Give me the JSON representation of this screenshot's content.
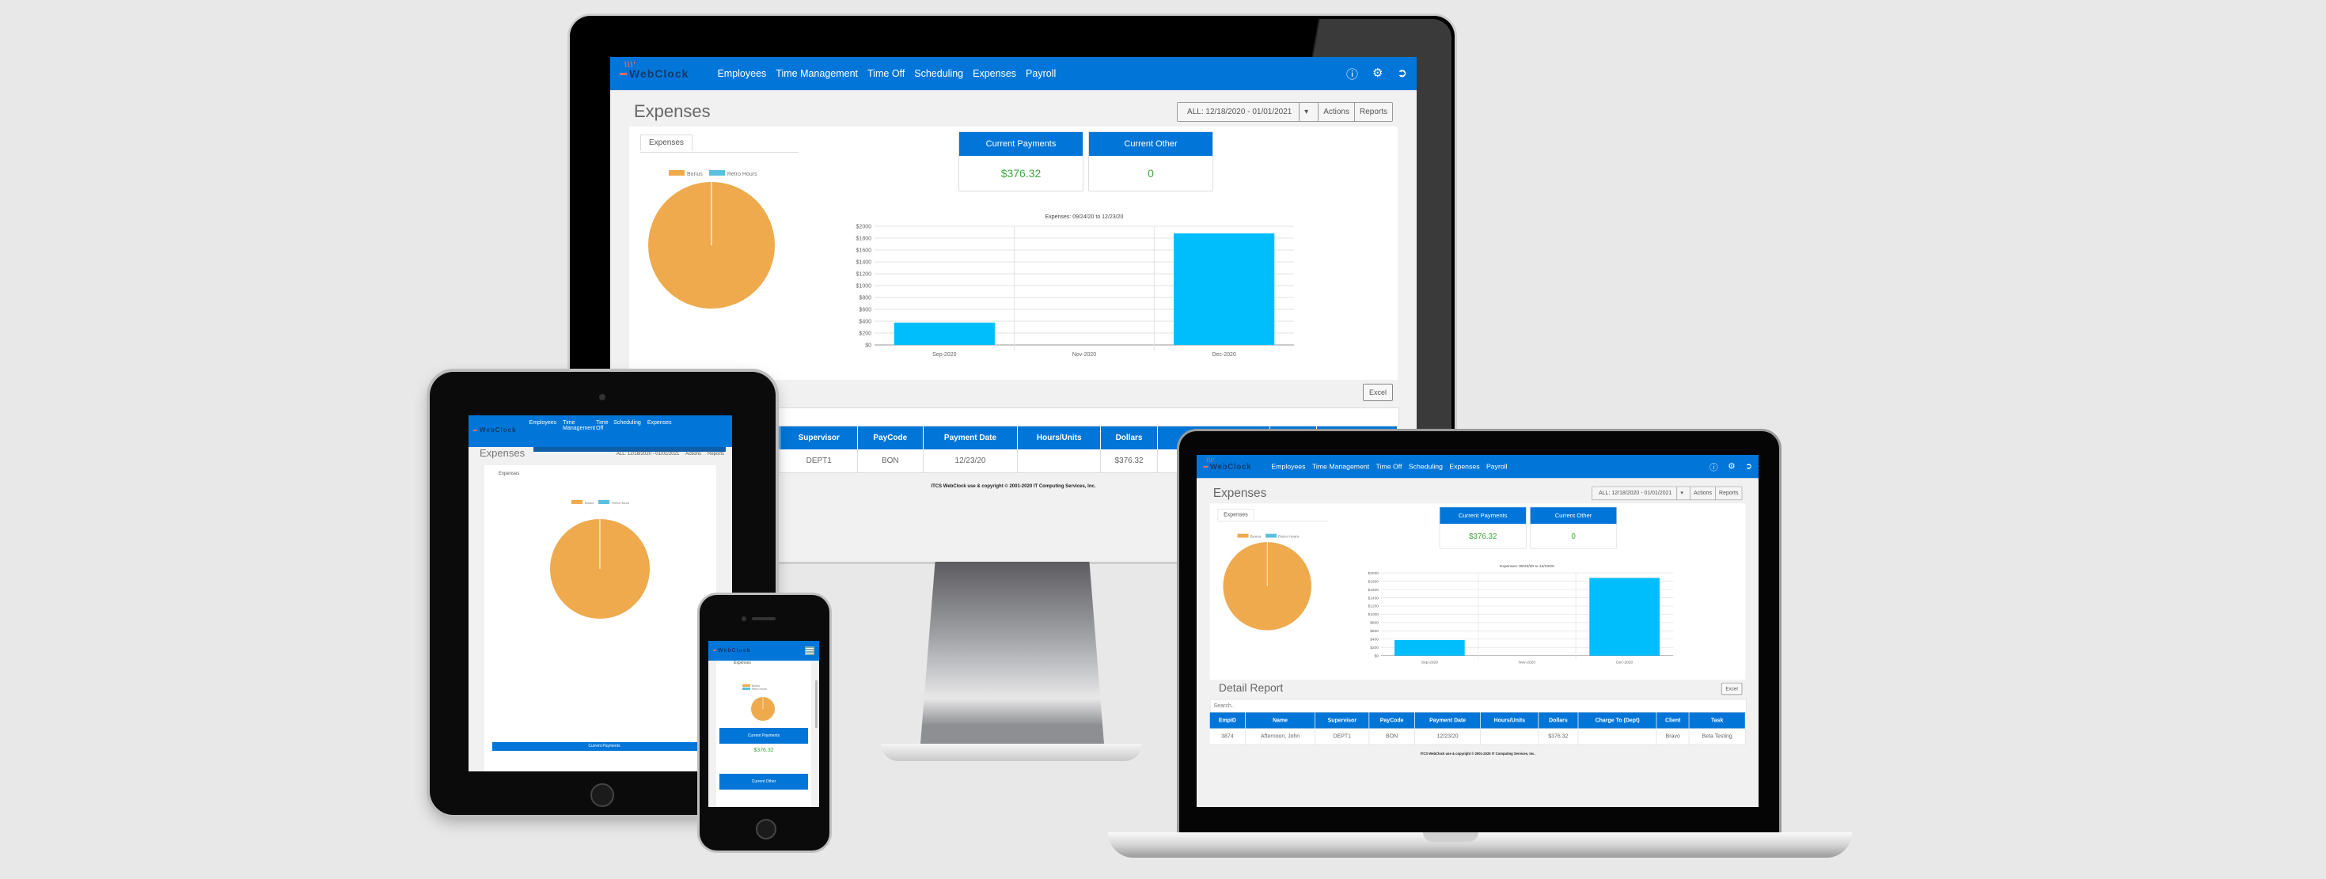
{
  "app": {
    "logo": "WebClock",
    "nav": [
      "Employees",
      "Time Management",
      "Time Off",
      "Scheduling",
      "Expenses",
      "Payroll"
    ],
    "nav_icons": [
      "help-icon",
      "gear-icon",
      "logout-icon"
    ],
    "page_title": "Expenses",
    "date_range": "ALL: 12/18/2020 - 01/01/2021",
    "actions_label": "Actions",
    "reports_label": "Reports",
    "tab_label": "Expenses",
    "cards": [
      {
        "title": "Current Payments",
        "value": "$376.32"
      },
      {
        "title": "Current Other",
        "value": "0"
      }
    ],
    "detail_title": "Detail Report",
    "excel_label": "Excel",
    "search_placeholder": "Search..",
    "table": {
      "columns": [
        "EmpID",
        "Name",
        "Supervisor",
        "PayCode",
        "Payment Date",
        "Hours/Units",
        "Dollars",
        "Charge To (Dept)",
        "Client",
        "Task"
      ],
      "rows": [
        [
          "3874",
          "Afternoon, John",
          "DEPT1",
          "BON",
          "12/23/20",
          "",
          "$376.32",
          "",
          "Bravo",
          "Beta Testing"
        ]
      ]
    },
    "footer": "ITCS WebClock use & copyright © 2001-2020 IT Computing Services, Inc.",
    "colors": {
      "primary": "#0276d8",
      "bonus": "#eeaa4d",
      "retro": "#5bc0de",
      "bar": "#00bdfb",
      "positive": "#3ea73e"
    }
  },
  "chart_data": [
    {
      "type": "pie",
      "title": "",
      "legend": [
        "Bonus",
        "Retro Hours"
      ],
      "categories": [
        "Bonus",
        "Retro Hours"
      ],
      "values": [
        100,
        0
      ],
      "legend_position": "top"
    },
    {
      "type": "bar",
      "title": "Expenses: 09/24/20 to 12/23/20",
      "categories": [
        "Sep-2020",
        "Nov-2020",
        "Dec-2020"
      ],
      "values": [
        376.32,
        0,
        1880
      ],
      "xlabel": "",
      "ylabel": "",
      "ylim": [
        0,
        2000
      ],
      "yticks": [
        "$0",
        "$200",
        "$400",
        "$600",
        "$800",
        "$1000",
        "$1200",
        "$1400",
        "$1600",
        "$1800",
        "$2000"
      ],
      "grid": true
    }
  ]
}
